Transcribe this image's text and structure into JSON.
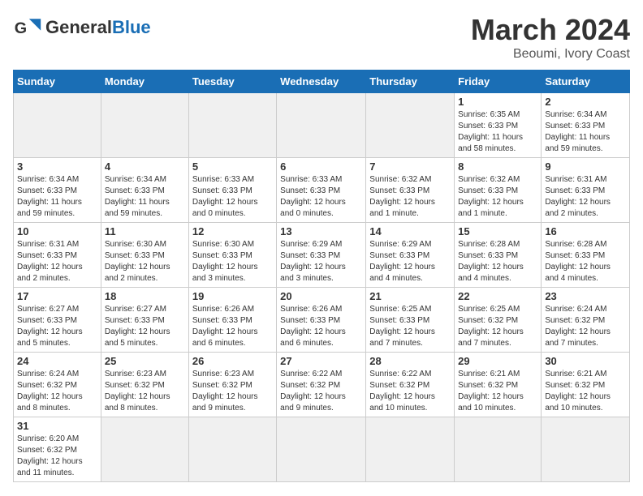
{
  "logo": {
    "text_general": "General",
    "text_blue": "Blue"
  },
  "title": "March 2024",
  "subtitle": "Beoumi, Ivory Coast",
  "days_of_week": [
    "Sunday",
    "Monday",
    "Tuesday",
    "Wednesday",
    "Thursday",
    "Friday",
    "Saturday"
  ],
  "weeks": [
    [
      {
        "day": "",
        "info": "",
        "empty": true
      },
      {
        "day": "",
        "info": "",
        "empty": true
      },
      {
        "day": "",
        "info": "",
        "empty": true
      },
      {
        "day": "",
        "info": "",
        "empty": true
      },
      {
        "day": "",
        "info": "",
        "empty": true
      },
      {
        "day": "1",
        "info": "Sunrise: 6:35 AM\nSunset: 6:33 PM\nDaylight: 11 hours\nand 58 minutes.",
        "empty": false
      },
      {
        "day": "2",
        "info": "Sunrise: 6:34 AM\nSunset: 6:33 PM\nDaylight: 11 hours\nand 59 minutes.",
        "empty": false
      }
    ],
    [
      {
        "day": "3",
        "info": "Sunrise: 6:34 AM\nSunset: 6:33 PM\nDaylight: 11 hours\nand 59 minutes.",
        "empty": false
      },
      {
        "day": "4",
        "info": "Sunrise: 6:34 AM\nSunset: 6:33 PM\nDaylight: 11 hours\nand 59 minutes.",
        "empty": false
      },
      {
        "day": "5",
        "info": "Sunrise: 6:33 AM\nSunset: 6:33 PM\nDaylight: 12 hours\nand 0 minutes.",
        "empty": false
      },
      {
        "day": "6",
        "info": "Sunrise: 6:33 AM\nSunset: 6:33 PM\nDaylight: 12 hours\nand 0 minutes.",
        "empty": false
      },
      {
        "day": "7",
        "info": "Sunrise: 6:32 AM\nSunset: 6:33 PM\nDaylight: 12 hours\nand 1 minute.",
        "empty": false
      },
      {
        "day": "8",
        "info": "Sunrise: 6:32 AM\nSunset: 6:33 PM\nDaylight: 12 hours\nand 1 minute.",
        "empty": false
      },
      {
        "day": "9",
        "info": "Sunrise: 6:31 AM\nSunset: 6:33 PM\nDaylight: 12 hours\nand 2 minutes.",
        "empty": false
      }
    ],
    [
      {
        "day": "10",
        "info": "Sunrise: 6:31 AM\nSunset: 6:33 PM\nDaylight: 12 hours\nand 2 minutes.",
        "empty": false
      },
      {
        "day": "11",
        "info": "Sunrise: 6:30 AM\nSunset: 6:33 PM\nDaylight: 12 hours\nand 2 minutes.",
        "empty": false
      },
      {
        "day": "12",
        "info": "Sunrise: 6:30 AM\nSunset: 6:33 PM\nDaylight: 12 hours\nand 3 minutes.",
        "empty": false
      },
      {
        "day": "13",
        "info": "Sunrise: 6:29 AM\nSunset: 6:33 PM\nDaylight: 12 hours\nand 3 minutes.",
        "empty": false
      },
      {
        "day": "14",
        "info": "Sunrise: 6:29 AM\nSunset: 6:33 PM\nDaylight: 12 hours\nand 4 minutes.",
        "empty": false
      },
      {
        "day": "15",
        "info": "Sunrise: 6:28 AM\nSunset: 6:33 PM\nDaylight: 12 hours\nand 4 minutes.",
        "empty": false
      },
      {
        "day": "16",
        "info": "Sunrise: 6:28 AM\nSunset: 6:33 PM\nDaylight: 12 hours\nand 4 minutes.",
        "empty": false
      }
    ],
    [
      {
        "day": "17",
        "info": "Sunrise: 6:27 AM\nSunset: 6:33 PM\nDaylight: 12 hours\nand 5 minutes.",
        "empty": false
      },
      {
        "day": "18",
        "info": "Sunrise: 6:27 AM\nSunset: 6:33 PM\nDaylight: 12 hours\nand 5 minutes.",
        "empty": false
      },
      {
        "day": "19",
        "info": "Sunrise: 6:26 AM\nSunset: 6:33 PM\nDaylight: 12 hours\nand 6 minutes.",
        "empty": false
      },
      {
        "day": "20",
        "info": "Sunrise: 6:26 AM\nSunset: 6:33 PM\nDaylight: 12 hours\nand 6 minutes.",
        "empty": false
      },
      {
        "day": "21",
        "info": "Sunrise: 6:25 AM\nSunset: 6:33 PM\nDaylight: 12 hours\nand 7 minutes.",
        "empty": false
      },
      {
        "day": "22",
        "info": "Sunrise: 6:25 AM\nSunset: 6:32 PM\nDaylight: 12 hours\nand 7 minutes.",
        "empty": false
      },
      {
        "day": "23",
        "info": "Sunrise: 6:24 AM\nSunset: 6:32 PM\nDaylight: 12 hours\nand 7 minutes.",
        "empty": false
      }
    ],
    [
      {
        "day": "24",
        "info": "Sunrise: 6:24 AM\nSunset: 6:32 PM\nDaylight: 12 hours\nand 8 minutes.",
        "empty": false
      },
      {
        "day": "25",
        "info": "Sunrise: 6:23 AM\nSunset: 6:32 PM\nDaylight: 12 hours\nand 8 minutes.",
        "empty": false
      },
      {
        "day": "26",
        "info": "Sunrise: 6:23 AM\nSunset: 6:32 PM\nDaylight: 12 hours\nand 9 minutes.",
        "empty": false
      },
      {
        "day": "27",
        "info": "Sunrise: 6:22 AM\nSunset: 6:32 PM\nDaylight: 12 hours\nand 9 minutes.",
        "empty": false
      },
      {
        "day": "28",
        "info": "Sunrise: 6:22 AM\nSunset: 6:32 PM\nDaylight: 12 hours\nand 10 minutes.",
        "empty": false
      },
      {
        "day": "29",
        "info": "Sunrise: 6:21 AM\nSunset: 6:32 PM\nDaylight: 12 hours\nand 10 minutes.",
        "empty": false
      },
      {
        "day": "30",
        "info": "Sunrise: 6:21 AM\nSunset: 6:32 PM\nDaylight: 12 hours\nand 10 minutes.",
        "empty": false
      }
    ],
    [
      {
        "day": "31",
        "info": "Sunrise: 6:20 AM\nSunset: 6:32 PM\nDaylight: 12 hours\nand 11 minutes.",
        "empty": false
      },
      {
        "day": "",
        "info": "",
        "empty": true
      },
      {
        "day": "",
        "info": "",
        "empty": true
      },
      {
        "day": "",
        "info": "",
        "empty": true
      },
      {
        "day": "",
        "info": "",
        "empty": true
      },
      {
        "day": "",
        "info": "",
        "empty": true
      },
      {
        "day": "",
        "info": "",
        "empty": true
      }
    ]
  ]
}
